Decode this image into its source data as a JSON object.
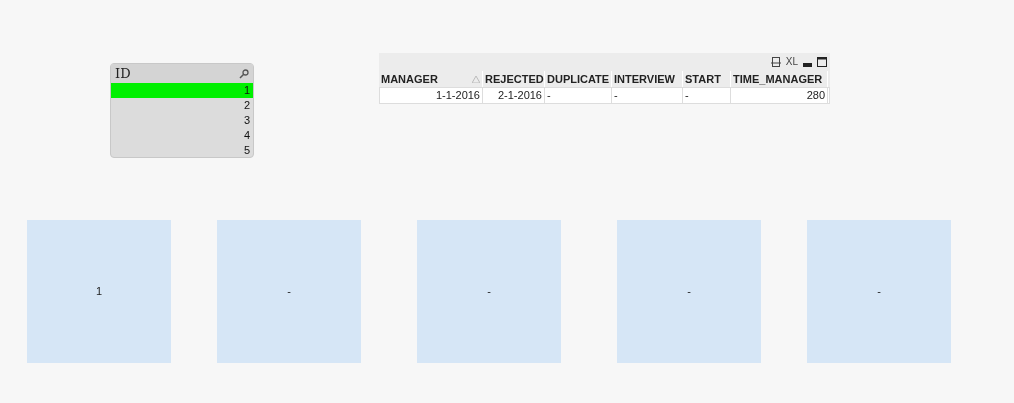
{
  "listbox": {
    "title": "ID",
    "items": [
      {
        "label": "1",
        "selected": true
      },
      {
        "label": "2",
        "selected": false
      },
      {
        "label": "3",
        "selected": false
      },
      {
        "label": "4",
        "selected": false
      },
      {
        "label": "5",
        "selected": false
      }
    ]
  },
  "table": {
    "toolbar_text": "XL",
    "columns": [
      "MANAGER",
      "REJECTED",
      "DUPLICATE",
      "INTERVIEW",
      "START",
      "TIME_MANAGER"
    ],
    "rows": [
      [
        "1-1-2016",
        "2-1-2016",
        "-",
        "-",
        "-",
        "280"
      ]
    ]
  },
  "text_boxes": [
    "1",
    "-",
    "-",
    "-",
    "-"
  ]
}
